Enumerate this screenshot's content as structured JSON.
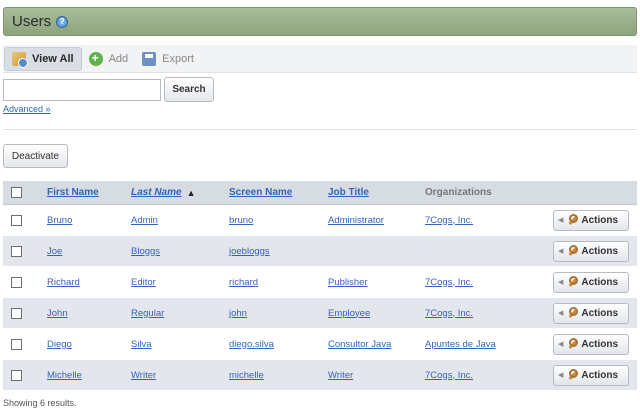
{
  "header": {
    "title": "Users",
    "help_glyph": "?"
  },
  "toolbar": {
    "view_all": {
      "label": "View All",
      "icon": "users-view-icon"
    },
    "add": {
      "label": "Add",
      "icon": "add-icon"
    },
    "export": {
      "label": "Export",
      "icon": "export-icon"
    }
  },
  "search": {
    "value": "",
    "placeholder": "",
    "button_label": "Search",
    "advanced_label": "Advanced »"
  },
  "deactivate_label": "Deactivate",
  "table": {
    "columns": [
      "First Name",
      "Last Name",
      "Screen Name",
      "Job Title",
      "Organizations"
    ],
    "sort_column": "Last Name",
    "sort_arrow": "▲",
    "rows": [
      {
        "first": "Bruno",
        "last": "Admin",
        "screen": "bruno",
        "job": "Administrator",
        "org": "7Cogs, Inc."
      },
      {
        "first": "Joe",
        "last": "Bloggs",
        "screen": "joebloggs",
        "job": "",
        "org": ""
      },
      {
        "first": "Richard",
        "last": "Editor",
        "screen": "richard",
        "job": "Publisher",
        "org": "7Cogs, Inc."
      },
      {
        "first": "John",
        "last": "Regular",
        "screen": "john",
        "job": "Employee",
        "org": "7Cogs, Inc."
      },
      {
        "first": "Diego",
        "last": "Silva",
        "screen": "diego.silva",
        "job": "Consultor Java",
        "org": "Apuntes de Java"
      },
      {
        "first": "Michelle",
        "last": "Writer",
        "screen": "michelle",
        "job": "Writer",
        "org": "7Cogs, Inc."
      }
    ],
    "actions_label": "Actions"
  },
  "results_text": "Showing 6 results.",
  "colors": {
    "header_bar": "#a8bc9a",
    "link": "#3463b8",
    "row_alt": "#e3e6ec",
    "grid_head": "#d7dbe2"
  }
}
